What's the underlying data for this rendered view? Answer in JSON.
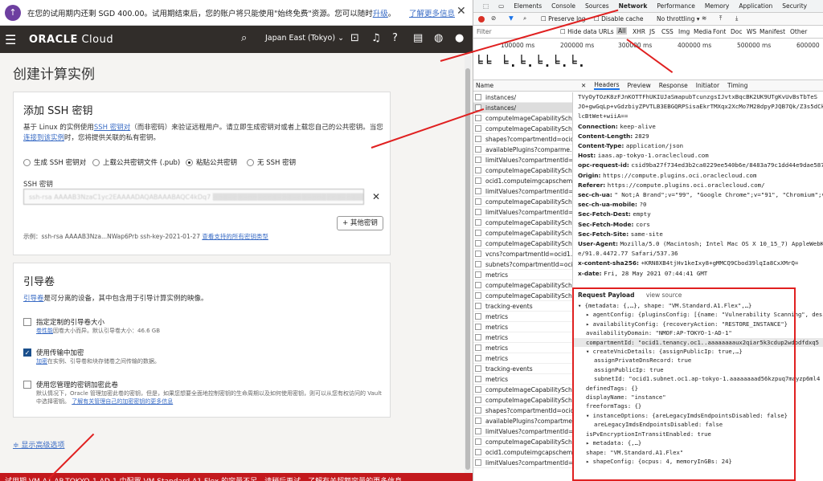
{
  "trial": {
    "text": "在您的试用期内还剩 SGD 400.00。试用期结束后，您的账户将只能使用\"始终免费\"资源。您可以随时",
    "upgrade": "升级",
    "more": "了解更多信息"
  },
  "header": {
    "brand": "ORACLE",
    "brand2": " Cloud",
    "region": "Japan East (Tokyo)"
  },
  "page_title": "创建计算实例",
  "ssh": {
    "title": "添加 SSH 密钥",
    "desc1": "基于 Linux 的实例使用",
    "desc_link1": "SSH 密钥对",
    "desc2": "（而非密码）来验证远程用户。请立即生成密钥对或者上载您自己的公共密钥。当您",
    "desc_link2": "连接到该实例",
    "desc3": "时，您将提供关联的私有密钥。",
    "options": [
      "生成 SSH 密钥对",
      "上载公共密钥文件 (.pub)",
      "粘贴公共密钥",
      "无 SSH 密钥"
    ],
    "field_label": "SSH 密钥",
    "field_value": "ssh-rsa AAAAB3NzaC1yc2EAAAADAQABAAABAQC4kDq7 ▒▒▒▒▒▒▒▒▒▒▒▒▒▒▒▒▒▒▒▒▒▒▒▒▒▒▒▒▒▒▒",
    "other_key": "+ 其他密钥",
    "example": "示例：ssh-rsa AAAAB3Nza...NWap6Prb ssh-key-2021-01-27",
    "example_link": "查看支持的所有密钥类型"
  },
  "boot": {
    "title": "引导卷",
    "desc_link": "引导卷",
    "desc": "是可分离的设备，其中包含用于引导计算实例的映像。",
    "opt1_title": "指定定制的引导卷大小",
    "opt1_link": "卷性能",
    "opt1_sub": "因卷大小而异。默认引导卷大小：46.6 GB",
    "opt2_title": "使用传输中加密",
    "opt2_link": "加密",
    "opt2_sub": "在实例、引导卷和块存储卷之间传输的数据。",
    "opt3_title": "使用您管理的密钥加密此卷",
    "opt3_sub": "默认情况下，Oracle 管理加密此卷的密钥，但是，如果您想要全面地控制密钥的生命周期以及如何使用密钥，则可以从您有权访问的 Vault 中选择密钥。",
    "opt3_link": "了解有关管理自己的加密密钥的更多信息"
  },
  "advanced": "显示高级选项",
  "error_bar": "试用期 VM.A1 AP-TOKYO-1-AD-1 中配置 VM.Standard.A1.Flex 的容量不足。请稍后再试。了解有关超额容量的更多信息",
  "devtools": {
    "tabs": [
      "Elements",
      "Console",
      "Sources",
      "Network",
      "Performance",
      "Memory",
      "Application",
      "Security"
    ],
    "preserve_log": "Preserve log",
    "disable_cache": "Disable cache",
    "throttling": "No throttling",
    "filter": "Filter",
    "hide_data": "Hide data URLs",
    "types": [
      "All",
      "XHR",
      "JS",
      "CSS",
      "Img",
      "Media",
      "Font",
      "Doc",
      "WS",
      "Manifest",
      "Other"
    ],
    "ticks": [
      "100000 ms",
      "200000 ms",
      "300000 ms",
      "400000 ms",
      "500000 ms",
      "600000"
    ],
    "name_header": "Name",
    "detail_tabs": [
      "Headers",
      "Preview",
      "Response",
      "Initiator",
      "Timing"
    ],
    "requests": [
      "instances/",
      "instances/",
      "computeImageCapabilitySch.",
      "computeImageCapabilitySch.",
      "shapes?compartmentId=ocid",
      "availablePlugins?comparme.",
      "limitValues?compartmentId=",
      "computeImageCapabilitySch.",
      "ocid1.computeimgcapschem.",
      "limitValues?compartmentId=",
      "computeImageCapabilitySch.",
      "limitValues?compartmentId=",
      "computeImageCapabilitySch.",
      "computeImageCapabilitySch.",
      "computeImageCapabilitySch.",
      "vcns?compartmentId=ocid1.",
      "subnets?compartmentId=ocid.",
      "metrics",
      "computeImageCapabilitySch.",
      "computeImageCapabilitySch.",
      "tracking-events",
      "metrics",
      "metrics",
      "metrics",
      "metrics",
      "metrics",
      "tracking-events",
      "metrics",
      "computeImageCapabilitySch.",
      "computeImageCapabilitySch.",
      "shapes?compartmentId=ocid",
      "availablePlugins?compartme.",
      "limitValues?compartmentId=",
      "computeImageCapabilitySch.",
      "ocid1.computeimgcapschem.",
      "limitValues?compartmentId="
    ],
    "headers": [
      {
        "k": "",
        "v": "TVyOyTOzK8zFJnKOTTFhUKIUJaSmapubTcunzgsIJvtxBqcBK2UK9UTgKvUvBsTbTeS"
      },
      {
        "k": "",
        "v": "JO+gwGqLp+vGdzbiyZPVTLB3EBGQRPSisaEkrTMXqx2XcMo7M28dpyPJQB7Qk/Z3s5dCk"
      },
      {
        "k": "",
        "v": "lcBtWet+wiiA=="
      },
      {
        "k": "Connection: ",
        "v": "keep-alive"
      },
      {
        "k": "Content-Length: ",
        "v": "2829"
      },
      {
        "k": "Content-Type: ",
        "v": "application/json"
      },
      {
        "k": "Host: ",
        "v": "iaas.ap-tokyo-1.oraclecloud.com"
      },
      {
        "k": "opc-request-id: ",
        "v": "csid9ba27f734ed3b2ca0229ee540b6e/8483a79c1dd44e9dae5872"
      },
      {
        "k": "Origin: ",
        "v": "https://compute.plugins.oci.oraclecloud.com"
      },
      {
        "k": "Referer: ",
        "v": "https://compute.plugins.oci.oraclecloud.com/"
      },
      {
        "k": "sec-ch-ua: ",
        "v": "\" Not;A Brand\";v=\"99\", \"Google Chrome\";v=\"91\", \"Chromium\";v"
      },
      {
        "k": "sec-ch-ua-mobile: ",
        "v": "?0"
      },
      {
        "k": "Sec-Fetch-Dest: ",
        "v": "empty"
      },
      {
        "k": "Sec-Fetch-Mode: ",
        "v": "cors"
      },
      {
        "k": "Sec-Fetch-Site: ",
        "v": "same-site"
      },
      {
        "k": "User-Agent: ",
        "v": "Mozilla/5.0 (Macintosh; Intel Mac OS X 10_15_7) AppleWebKi"
      },
      {
        "k": "",
        "v": "e/91.0.4472.77 Safari/537.36"
      },
      {
        "k": "x-content-sha256: ",
        "v": "+KRN8XB4tjHv1keIxy8+gMMCQ9Cbod39lqIa8CxXMrQ="
      },
      {
        "k": "x-date: ",
        "v": "Fri, 28 May 2021 07:44:41 GMT"
      }
    ],
    "payload_title": "Request Payload",
    "view_source": "view source",
    "payload": [
      {
        "i": 0,
        "t": "▾ {metadata: {,…}, shape: \"VM.Standard.A1.Flex\",…}"
      },
      {
        "i": 1,
        "t": "▸ agentConfig: {pluginsConfig: [{name: \"Vulnerability Scanning\", desi"
      },
      {
        "i": 1,
        "t": "▸ availabilityConfig: {recoveryAction: \"RESTORE_INSTANCE\"}"
      },
      {
        "i": 1,
        "t": "  availabilityDomain: \"NMOF:AP-TOKYO-1-AD-1\""
      },
      {
        "i": 1,
        "t": "  compartmentId: \"ocid1.tenancy.oc1..aaaaaaaaux2qiar5k3cdup2wdpdfdxq5"
      },
      {
        "i": 1,
        "t": "▾ createVnicDetails: {assignPublicIp: true,…}"
      },
      {
        "i": 2,
        "t": "  assignPrivateDnsRecord: true"
      },
      {
        "i": 2,
        "t": "  assignPublicIp: true"
      },
      {
        "i": 2,
        "t": "  subnetId: \"ocid1.subnet.oc1.ap-tokyo-1.aaaaaaaad56kzpuq7mayzp6ml4"
      },
      {
        "i": 1,
        "t": "  definedTags: {}"
      },
      {
        "i": 1,
        "t": "  displayName: \"instance\""
      },
      {
        "i": 1,
        "t": "  freeformTags: {}"
      },
      {
        "i": 1,
        "t": "▾ instanceOptions: {areLegacyImdsEndpointsDisabled: false}"
      },
      {
        "i": 2,
        "t": "  areLegacyImdsEndpointsDisabled: false"
      },
      {
        "i": 1,
        "t": "  isPvEncryptionInTransitEnabled: true"
      },
      {
        "i": 1,
        "t": "▸ metadata: {,…}"
      },
      {
        "i": 1,
        "t": "  shape: \"VM.Standard.A1.Flex\""
      },
      {
        "i": 1,
        "t": "▸ shapeConfig: {ocpus: 4, memoryInGBs: 24}"
      }
    ]
  }
}
